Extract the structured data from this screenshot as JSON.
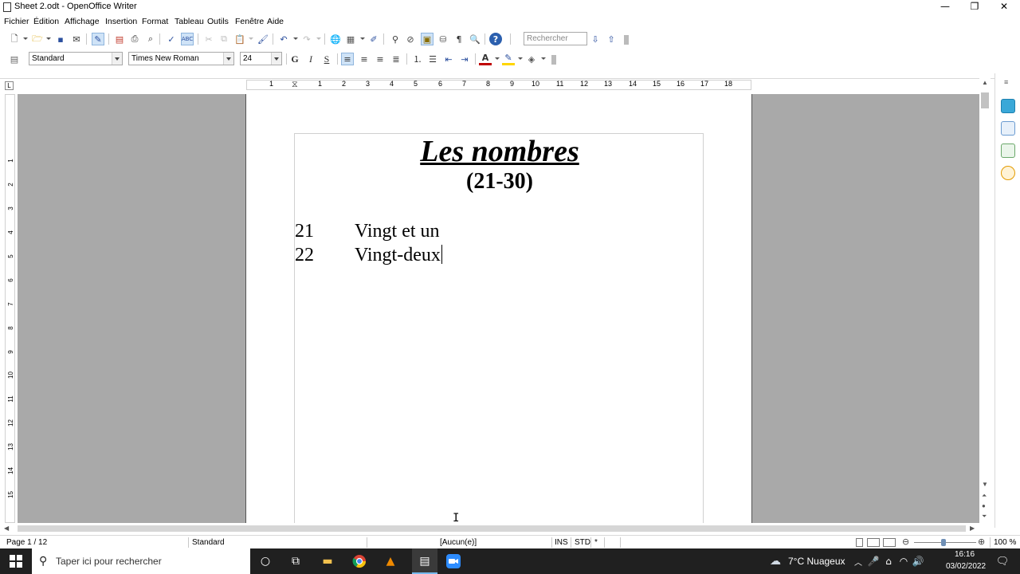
{
  "window": {
    "title": "Sheet 2.odt - OpenOffice Writer",
    "minimize_glyph": "—",
    "restore_glyph": "❐",
    "close_glyph": "✕"
  },
  "menu": {
    "items": [
      "Fichier",
      "Édition",
      "Affichage",
      "Insertion",
      "Format",
      "Tableau",
      "Outils",
      "Fenêtre",
      "Aide"
    ]
  },
  "toolbar": {
    "search_placeholder": "Rechercher"
  },
  "formatting": {
    "style": "Standard",
    "font": "Times New Roman",
    "size": "24",
    "bold_label": "G",
    "italic_label": "I",
    "underline_label": "S"
  },
  "ruler": {
    "h_marks": [
      "1",
      "1",
      "2",
      "3",
      "4",
      "5",
      "6",
      "7",
      "8",
      "9",
      "10",
      "11",
      "12",
      "13",
      "14",
      "15",
      "16",
      "17",
      "18"
    ],
    "v_marks": [
      "1",
      "1",
      "2",
      "3",
      "4",
      "5",
      "6",
      "7",
      "8",
      "9",
      "10",
      "11",
      "12",
      "13",
      "14",
      "15"
    ]
  },
  "document": {
    "title": "Les nombres",
    "subtitle": "(21-30)",
    "lines": [
      {
        "num": "21",
        "word": "Vingt et un"
      },
      {
        "num": "22",
        "word": "Vingt-deux"
      }
    ]
  },
  "status": {
    "page": "Page 1 / 12",
    "style": "Standard",
    "language": "[Aucun(e)]",
    "insert_mode": "INS",
    "selection_mode": "STD",
    "modified": "*",
    "zoom": "100 %"
  },
  "taskbar": {
    "search_text": "Taper ici pour rechercher",
    "weather": "7°C  Nuageux",
    "time": "16:16",
    "date": "03/02/2022"
  },
  "colors": {
    "workspace": "#a9a9a9",
    "taskbar": "#202020",
    "accent_blue": "#1e6fd9"
  }
}
